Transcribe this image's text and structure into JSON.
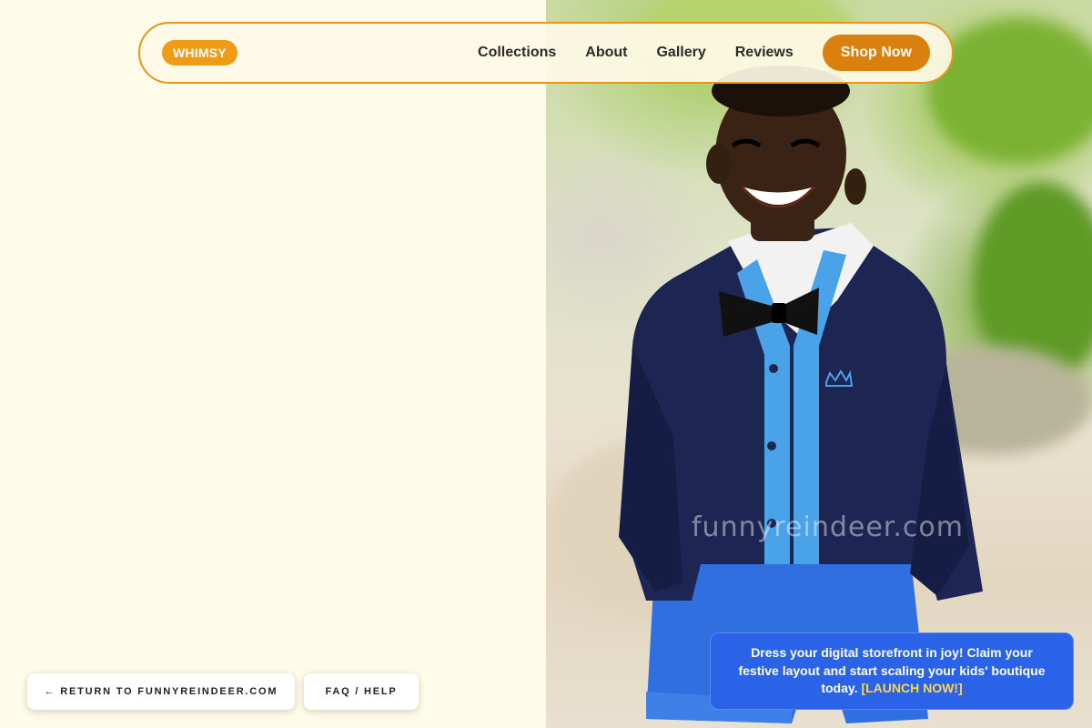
{
  "nav": {
    "logo": "WHIMSY",
    "links": [
      "Collections",
      "About",
      "Gallery",
      "Reviews"
    ],
    "cta": "Shop Now"
  },
  "hero_image": {
    "watermark": "funnyreindeer.com"
  },
  "footer_buttons": {
    "return_label": "← RETURN TO FUNNYREINDEER.COM",
    "faq_label": "FAQ / HELP"
  },
  "promo": {
    "text": "Dress your digital storefront in joy! Claim your festive layout and start scaling your kids' boutique today.",
    "link": "[LAUNCH NOW!]"
  },
  "colors": {
    "page_bg": "#fefbe8",
    "accent": "#e8951a",
    "cta": "#d9800e",
    "promo_bg": "#2a63e8",
    "promo_link": "#ffd84a"
  }
}
